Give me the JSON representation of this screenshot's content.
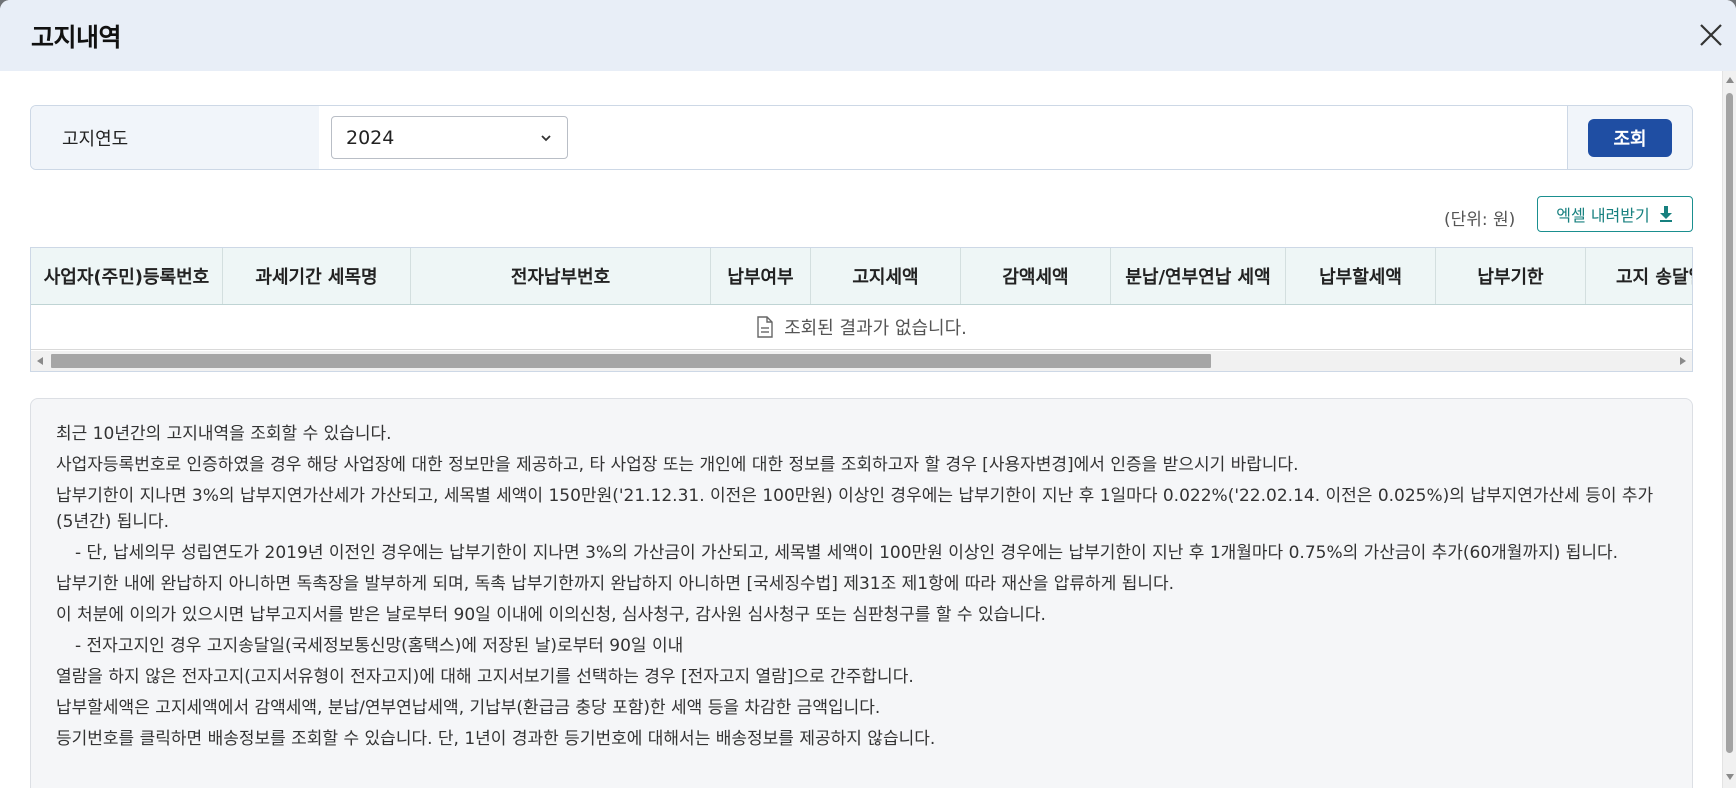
{
  "modal": {
    "title": "고지내역"
  },
  "search": {
    "label": "고지연도",
    "year_value": "2024",
    "button_label": "조회"
  },
  "toolbar": {
    "unit_text": "(단위: 원)",
    "excel_label": "엑셀 내려받기"
  },
  "table": {
    "columns": [
      "사업자(주민)등록번호",
      "과세기간 세목명",
      "전자납부번호",
      "납부여부",
      "고지세액",
      "감액세액",
      "분납/연부연납 세액",
      "납부할세액",
      "납부기한",
      "고지 송달일"
    ],
    "empty_message": "조회된 결과가 없습니다."
  },
  "notes": [
    "최근 10년간의 고지내역을 조회할 수 있습니다.",
    "사업자등록번호로 인증하였을 경우 해당 사업장에 대한 정보만을 제공하고, 타 사업장 또는 개인에 대한 정보를 조회하고자 할 경우 [사용자변경]에서 인증을 받으시기 바랍니다.",
    "납부기한이 지나면 3%의 납부지연가산세가 가산되고, 세목별 세액이 150만원('21.12.31. 이전은 100만원) 이상인 경우에는 납부기한이 지난 후 1일마다 0.022%('22.02.14. 이전은 0.025%)의 납부지연가산세 등이 추가(5년간) 됩니다.",
    "- 단, 납세의무 성립연도가 2019년 이전인 경우에는 납부기한이 지나면 3%의 가산금이 가산되고, 세목별 세액이 100만원 이상인 경우에는 납부기한이 지난 후 1개월마다 0.75%의 가산금이 추가(60개월까지) 됩니다.",
    "납부기한 내에 완납하지 아니하면 독촉장을 발부하게 되며, 독촉 납부기한까지 완납하지 아니하면 [국세징수법] 제31조 제1항에 따라 재산을 압류하게 됩니다.",
    "이 처분에 이의가 있으시면 납부고지서를 받은 날로부터 90일 이내에 이의신청, 심사청구, 감사원 심사청구 또는 심판청구를 할 수 있습니다.",
    "- 전자고지인 경우 고지송달일(국세정보통신망(홈택스)에 저장된 날)로부터 90일 이내",
    "열람을 하지 않은 전자고지(고지서유형이 전자고지)에 대해 고지서보기를 선택하는 경우 [전자고지 열람]으로 간주합니다.",
    "납부할세액은 고지세액에서 감액세액, 분납/연부연납세액, 기납부(환급금 충당 포함)한 세액 등을 차감한 금액입니다.",
    "등기번호를 클릭하면 배송정보를 조회할 수 있습니다. 단, 1년이 경과한 등기번호에 대해서는 배송정보를 제공하지 않습니다."
  ],
  "icons": {
    "close": "close-icon",
    "dropdown": "chevron-down-icon",
    "download": "download-icon",
    "document": "document-icon"
  },
  "colors": {
    "header_bg": "#e8eef7",
    "primary_button": "#1f4ea3",
    "excel_accent": "#17807f",
    "table_header_bg": "#eef6f6",
    "notes_bg": "#f5f6f8"
  }
}
